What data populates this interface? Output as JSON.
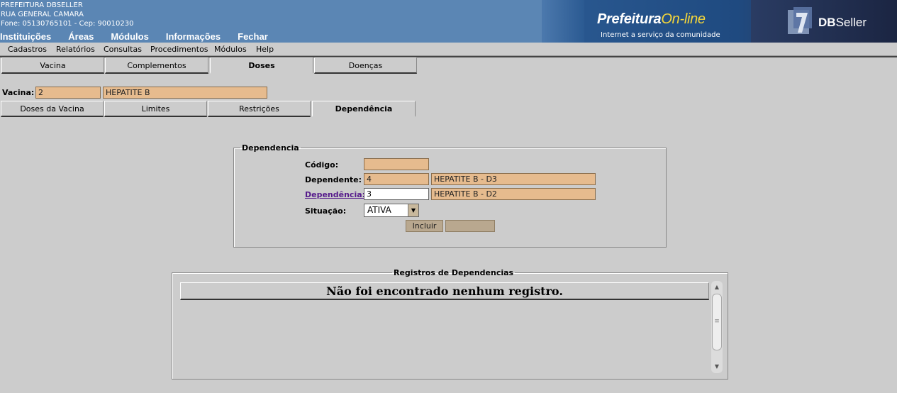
{
  "header": {
    "org_name": "PREFEITURA DBSELLER",
    "org_address": "RUA GENERAL CAMARA",
    "org_contact": "Fone: 05130765101  -  Cep: 90010230",
    "top_menu": [
      "Instituições",
      "Áreas",
      "Módulos",
      "Informações",
      "Fechar"
    ],
    "logo_prefeitura": "Prefeitura",
    "logo_online": "On-line",
    "logo_tagline": "Internet a serviço da comunidade",
    "logo_db": "DB",
    "logo_seller": "Seller"
  },
  "menu_bar": [
    "Cadastros",
    "Relatórios",
    "Consultas",
    "Procedimentos",
    "Módulos",
    "Help"
  ],
  "main_tabs": [
    "Vacina",
    "Complementos",
    "Doses",
    "Doenças"
  ],
  "vacina": {
    "label": "Vacina:",
    "code": "2",
    "name": "HEPATITE B"
  },
  "sub_tabs": [
    "Doses da Vacina",
    "Limites",
    "Restrições",
    "Dependência"
  ],
  "form": {
    "legend": "Dependencia",
    "codigo_label": "Código:",
    "codigo_value": "",
    "dependente_label": "Dependente:",
    "dependente_code": "4",
    "dependente_name": "HEPATITE B - D3",
    "dependencia_label": "Dependência:",
    "dependencia_code": "3",
    "dependencia_name": "HEPATITE B - D2",
    "situacao_label": "Situação:",
    "situacao_value": "ATIVA",
    "incluir_label": "Incluir",
    "second_button_label": ""
  },
  "grid": {
    "legend": "Registros de Dependencias",
    "empty_message": "Não foi encontrado nenhum registro."
  },
  "colors": {
    "header_bg": "#5b86b4",
    "readonly_field": "#e6bb8e",
    "button_bg": "#b9a88f",
    "page_bg": "#cccccc",
    "link": "#551a8b"
  }
}
